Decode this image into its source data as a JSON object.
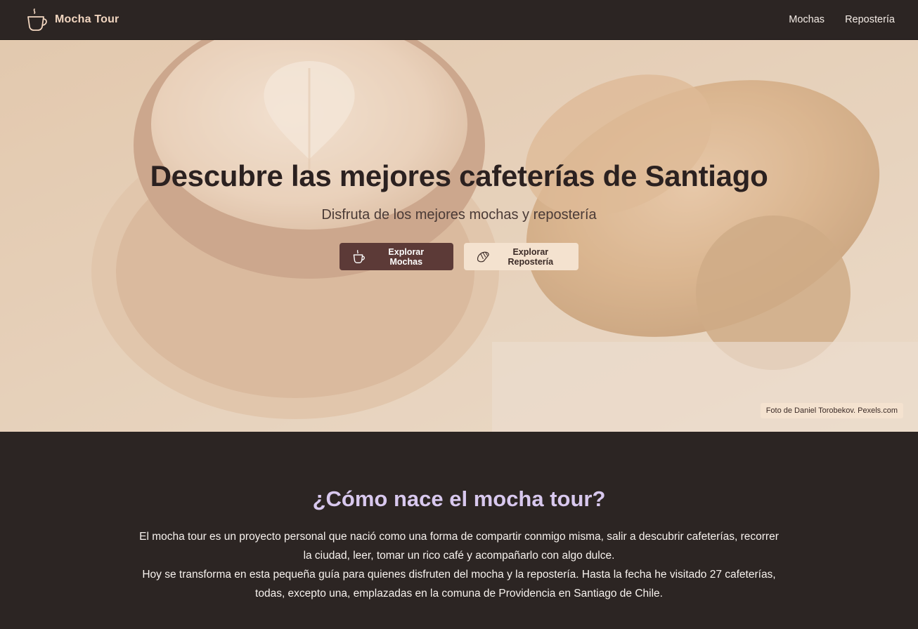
{
  "navbar": {
    "brand": "Mocha Tour",
    "brand_icon": "coffee-cup-icon",
    "links": [
      {
        "label": "Mochas"
      },
      {
        "label": "Repostería"
      }
    ]
  },
  "hero": {
    "title": "Descubre las mejores cafeterías de Santiago",
    "subtitle": "Disfruta de los mejores mochas y repostería",
    "buttons": {
      "primary": {
        "label": "Explorar Mochas",
        "icon": "coffee-cup-icon"
      },
      "secondary": {
        "label": "Explorar Repostería",
        "icon": "croissant-icon"
      }
    },
    "photo_credit": "Foto de Daniel Torobekov. Pexels.com"
  },
  "about": {
    "title": "¿Cómo nace el mocha tour?",
    "paragraph1": "El mocha tour es un proyecto personal que nació como una forma de compartir conmigo misma, salir a descubrir cafeterías, recorrer la ciudad, leer, tomar un rico café y acompañarlo con algo dulce.",
    "paragraph2": "Hoy se transforma en esta pequeña guía para quienes disfruten del mocha y la repostería. Hasta la fecha he visitado 27 cafeterías, todas, excepto una, emplazadas en la comuna de Providencia en Santiago de Chile."
  },
  "colors": {
    "nav_bg": "#2c2523",
    "brand": "#f2d6c0",
    "primary_button": "#5c3a37",
    "secondary_button": "#f4e2cf",
    "about_title": "#d8c8ee"
  }
}
